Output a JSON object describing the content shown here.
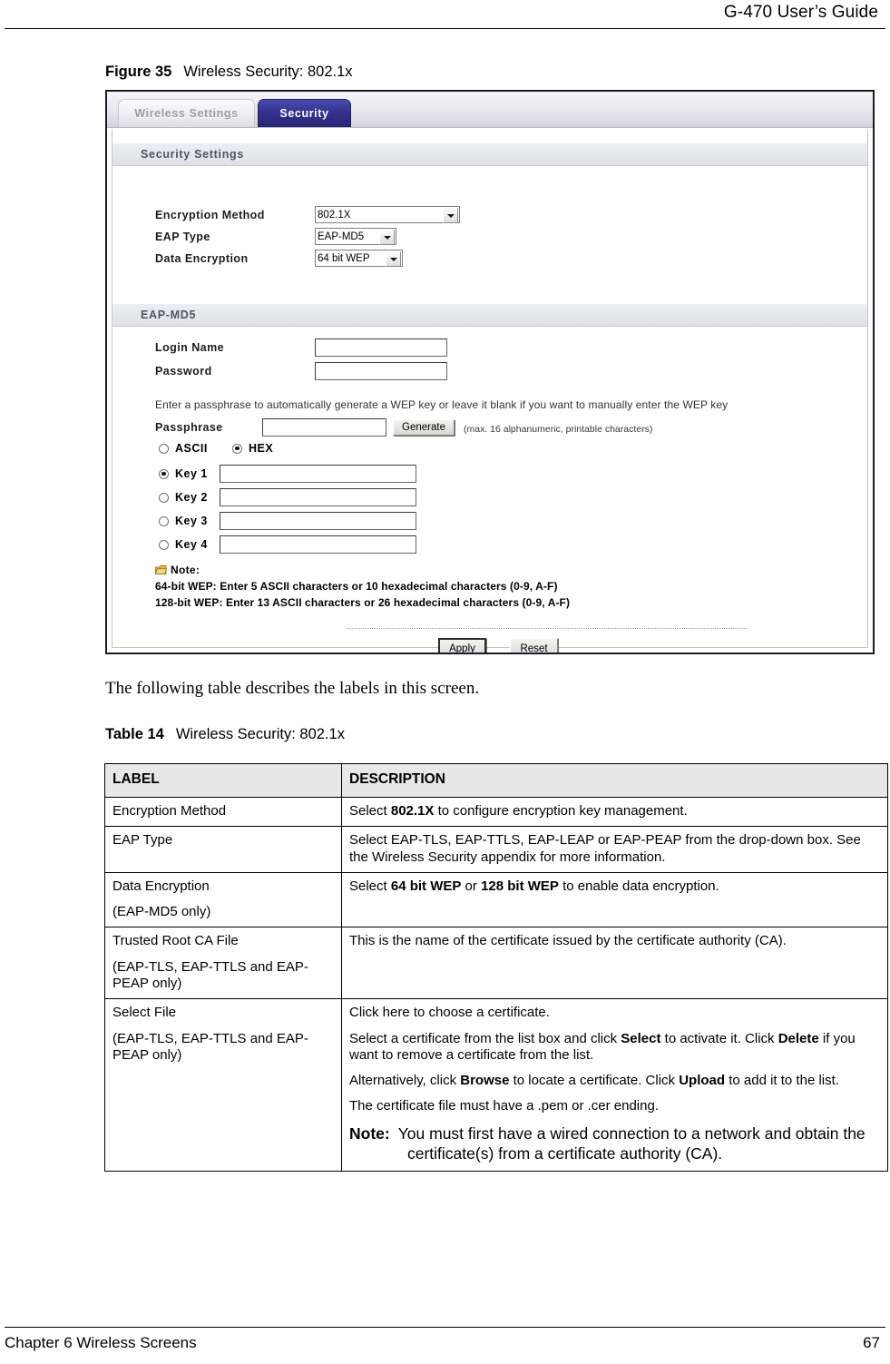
{
  "page": {
    "running_head": "G-470 User’s Guide",
    "footer_left": "Chapter 6 Wireless Screens",
    "footer_page_number": "67"
  },
  "figure": {
    "number": "Figure 35",
    "title": "Wireless Security: 802.1x"
  },
  "screenshot": {
    "tabs": [
      {
        "label": "Wireless Settings",
        "active": false
      },
      {
        "label": "Security",
        "active": true
      }
    ],
    "sections": {
      "security_settings_title": "Security Settings",
      "eap_md5_title": "EAP-MD5"
    },
    "fields": {
      "encryption_method_label": "Encryption Method",
      "encryption_method_value": "802.1X",
      "eap_type_label": "EAP Type",
      "eap_type_value": "EAP-MD5",
      "data_encryption_label": "Data Encryption",
      "data_encryption_value": "64 bit WEP",
      "login_name_label": "Login Name",
      "login_name_value": "",
      "password_label": "Password",
      "password_value": "",
      "passphrase_label": "Passphrase",
      "passphrase_value": ""
    },
    "passphrase_hint": "Enter a passphrase to automatically generate a WEP key or leave it blank if you want to manually enter the WEP key",
    "passphrase_limit": "(max. 16 alphanumeric, printable characters)",
    "generate_button": "Generate",
    "format_options": [
      {
        "label": "ASCII",
        "selected": false
      },
      {
        "label": "HEX",
        "selected": true
      }
    ],
    "keys": [
      {
        "label": "Key 1",
        "selected": true,
        "value": ""
      },
      {
        "label": "Key 2",
        "selected": false,
        "value": ""
      },
      {
        "label": "Key 3",
        "selected": false,
        "value": ""
      },
      {
        "label": "Key 4",
        "selected": false,
        "value": ""
      }
    ],
    "note": {
      "heading": "Note:",
      "lines": [
        "64-bit WEP: Enter 5 ASCII characters or 10 hexadecimal characters (0-9, A-F)",
        "128-bit WEP: Enter 13 ASCII characters or 26 hexadecimal characters (0-9, A-F)"
      ]
    },
    "actions": {
      "apply_button": "Apply",
      "reset_button": "Reset"
    },
    "colors": {
      "active_tab": "#33338f",
      "inactive_tab_text": "#9a9aa4",
      "section_bar": "#dee1e6"
    }
  },
  "intro_paragraph": "The following table describes the labels in this screen.",
  "table": {
    "number": "Table 14",
    "title": "Wireless Security: 802.1x",
    "headers": {
      "label": "LABEL",
      "description": "DESCRIPTION"
    },
    "rows": [
      {
        "label": "Encryption Method",
        "label_extra": "",
        "description_parts": [
          [
            {
              "t": "Select ",
              "b": false
            },
            {
              "t": "802.1X",
              "b": true
            },
            {
              "t": " to configure encryption key management.",
              "b": false
            }
          ]
        ]
      },
      {
        "label": "EAP Type",
        "label_extra": "",
        "description_parts": [
          [
            {
              "t": "Select EAP-TLS, EAP-TTLS, EAP-LEAP or EAP-PEAP from the drop-down box. See the Wireless Security appendix for more information.",
              "b": false
            }
          ]
        ]
      },
      {
        "label": "Data Encryption",
        "label_extra": "(EAP-MD5 only)",
        "description_parts": [
          [
            {
              "t": "Select ",
              "b": false
            },
            {
              "t": "64 bit WEP",
              "b": true
            },
            {
              "t": " or ",
              "b": false
            },
            {
              "t": "128 bit WEP",
              "b": true
            },
            {
              "t": " to enable data encryption.",
              "b": false
            }
          ]
        ]
      },
      {
        "label": "Trusted Root CA File",
        "label_extra": "(EAP-TLS, EAP-TTLS and EAP-PEAP only)",
        "description_parts": [
          [
            {
              "t": "This is the name of the certificate issued by the certificate authority (CA).",
              "b": false
            }
          ]
        ]
      },
      {
        "label": "Select File",
        "label_extra": "(EAP-TLS, EAP-TTLS and EAP-PEAP only)",
        "description_parts": [
          [
            {
              "t": "Click here to choose a certificate.",
              "b": false
            }
          ],
          [
            {
              "t": "Select a certificate from the list box and click ",
              "b": false
            },
            {
              "t": "Select",
              "b": true
            },
            {
              "t": " to activate it. Click ",
              "b": false
            },
            {
              "t": "Delete",
              "b": true
            },
            {
              "t": " if you want to remove a certificate from the list.",
              "b": false
            }
          ],
          [
            {
              "t": "Alternatively, click ",
              "b": false
            },
            {
              "t": "Browse",
              "b": true
            },
            {
              "t": " to locate a certificate. Click ",
              "b": false
            },
            {
              "t": "Upload",
              "b": true
            },
            {
              "t": " to add it to the list.",
              "b": false
            }
          ],
          [
            {
              "t": "The certificate file must have a .pem or .cer ending.",
              "b": false
            }
          ]
        ],
        "note": {
          "prefix": "Note:",
          "text": "You must first have a wired connection to a network and obtain the certificate(s) from a certificate authority (CA)."
        }
      }
    ]
  }
}
